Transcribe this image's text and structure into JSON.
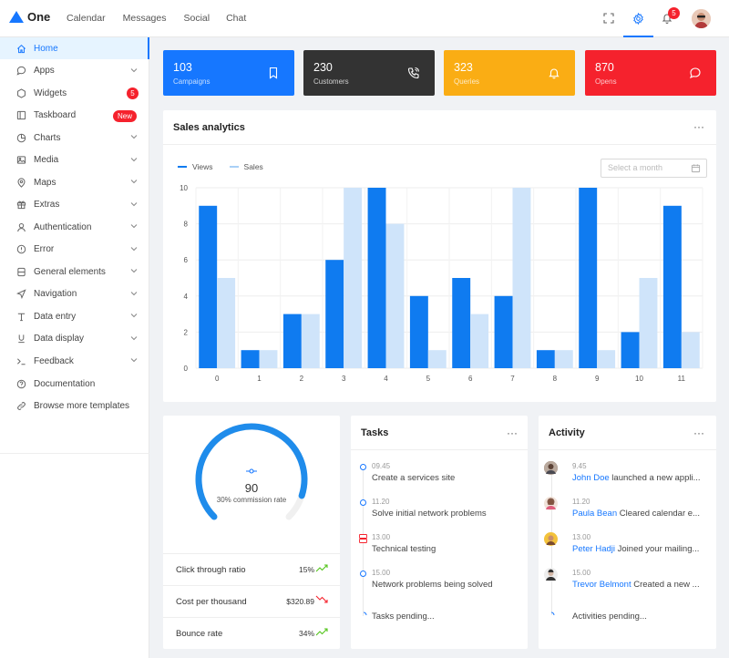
{
  "header": {
    "logo_text": "One",
    "nav": [
      "Calendar",
      "Messages",
      "Social",
      "Chat"
    ],
    "notification_count": "5"
  },
  "sidebar": {
    "items": [
      {
        "label": "Home",
        "icon": "home-icon",
        "active": true
      },
      {
        "label": "Apps",
        "icon": "message-icon",
        "chevron": true
      },
      {
        "label": "Widgets",
        "icon": "hexagon-icon",
        "badge": "5"
      },
      {
        "label": "Taskboard",
        "icon": "board-icon",
        "tag": "New"
      },
      {
        "label": "Charts",
        "icon": "pie-icon",
        "chevron": true
      },
      {
        "label": "Media",
        "icon": "image-icon",
        "chevron": true
      },
      {
        "label": "Maps",
        "icon": "pin-icon",
        "chevron": true
      },
      {
        "label": "Extras",
        "icon": "gift-icon",
        "chevron": true
      },
      {
        "label": "Authentication",
        "icon": "user-icon",
        "chevron": true
      },
      {
        "label": "Error",
        "icon": "alert-icon",
        "chevron": true
      },
      {
        "label": "General elements",
        "icon": "database-icon",
        "chevron": true
      },
      {
        "label": "Navigation",
        "icon": "send-icon",
        "chevron": true
      },
      {
        "label": "Data entry",
        "icon": "type-icon",
        "chevron": true
      },
      {
        "label": "Data display",
        "icon": "underline-icon",
        "chevron": true
      },
      {
        "label": "Feedback",
        "icon": "terminal-icon",
        "chevron": true
      },
      {
        "label": "Documentation",
        "icon": "help-icon"
      },
      {
        "label": "Browse more templates",
        "icon": "link-icon"
      }
    ]
  },
  "stats": [
    {
      "value": "103",
      "label": "Campaigns",
      "color": "#1677ff",
      "icon": "bookmark-icon"
    },
    {
      "value": "230",
      "label": "Customers",
      "color": "#333333",
      "icon": "phone-icon"
    },
    {
      "value": "323",
      "label": "Queries",
      "color": "#faad14",
      "icon": "bell-icon"
    },
    {
      "value": "870",
      "label": "Opens",
      "color": "#f5222d",
      "icon": "chat-icon"
    }
  ],
  "sales": {
    "title": "Sales analytics",
    "more": "···",
    "month_placeholder": "Select a month",
    "legend": [
      "Views",
      "Sales"
    ]
  },
  "chart_data": {
    "type": "bar",
    "categories": [
      "0",
      "1",
      "2",
      "3",
      "4",
      "5",
      "6",
      "7",
      "8",
      "9",
      "10",
      "11"
    ],
    "series": [
      {
        "name": "Views",
        "color": "#0f7bf0",
        "values": [
          9,
          1,
          3,
          6,
          10,
          4,
          5,
          4,
          1,
          10,
          2,
          9
        ]
      },
      {
        "name": "Sales",
        "color": "#cfe4fa",
        "values": [
          5,
          1,
          3,
          10,
          8,
          1,
          3,
          10,
          1,
          1,
          5,
          2
        ]
      }
    ],
    "ylim": [
      0,
      10
    ],
    "yticks": [
      "0",
      "2",
      "4",
      "6",
      "8",
      "10"
    ],
    "grid": true,
    "legend_position": "top-left"
  },
  "gauge": {
    "value": "90",
    "label": "30% commission rate",
    "fraction": 0.9,
    "metrics": [
      {
        "label": "Click through ratio",
        "value": "15%",
        "trend": "up"
      },
      {
        "label": "Cost per thousand",
        "value": "$320.89",
        "trend": "down"
      },
      {
        "label": "Bounce rate",
        "value": "34%",
        "trend": "up"
      }
    ]
  },
  "tasks": {
    "title": "Tasks",
    "more": "···",
    "items": [
      {
        "time": "09.45",
        "text": "Create a services site"
      },
      {
        "time": "11.20",
        "text": "Solve initial network problems"
      },
      {
        "time": "13.00",
        "text": "Technical testing"
      },
      {
        "time": "15.00",
        "text": "Network problems being solved"
      }
    ],
    "pending": "Tasks pending..."
  },
  "activity": {
    "title": "Activity",
    "more": "···",
    "items": [
      {
        "time": "9.45",
        "name": "John Doe",
        "text": " launched a new appli..."
      },
      {
        "time": "11.20",
        "name": "Paula Bean",
        "text": " Cleared calendar e..."
      },
      {
        "time": "13.00",
        "name": "Peter Hadji",
        "text": " Joined your mailing..."
      },
      {
        "time": "15.00",
        "name": "Trevor Belmont",
        "text": " Created a new ..."
      }
    ],
    "pending": "Activities pending..."
  }
}
